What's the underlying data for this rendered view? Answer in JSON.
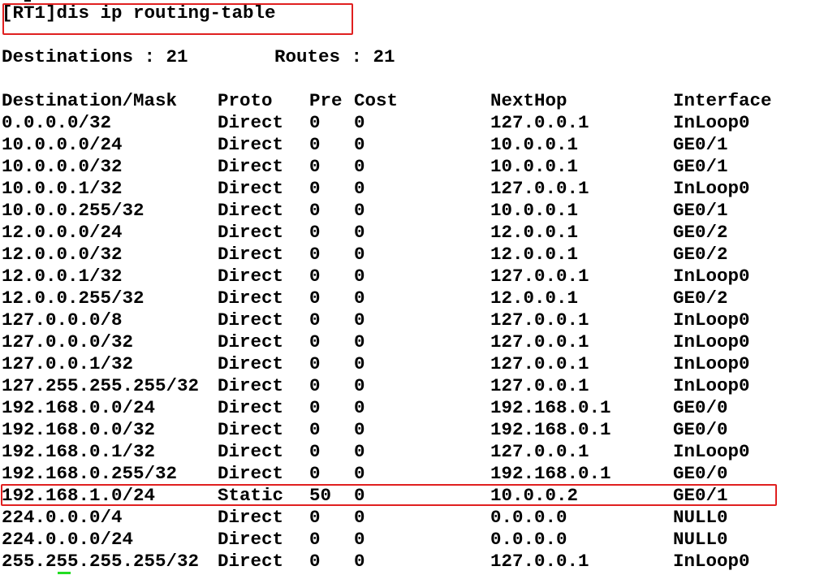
{
  "terminal": {
    "command_line": "[RT1]dis ip routing-table",
    "summary": {
      "destinations": "Destinations : 21",
      "routes": "Routes : 21"
    },
    "headers": {
      "destination_mask": "Destination/Mask",
      "proto": "Proto",
      "pre": "Pre",
      "cost": "Cost",
      "nexthop": "NextHop",
      "interface": "Interface"
    },
    "rows": [
      {
        "dest": "0.0.0.0/32",
        "proto": "Direct",
        "pre": "0",
        "cost": "0",
        "nexthop": "127.0.0.1",
        "iface": "InLoop0"
      },
      {
        "dest": "10.0.0.0/24",
        "proto": "Direct",
        "pre": "0",
        "cost": "0",
        "nexthop": "10.0.0.1",
        "iface": "GE0/1"
      },
      {
        "dest": "10.0.0.0/32",
        "proto": "Direct",
        "pre": "0",
        "cost": "0",
        "nexthop": "10.0.0.1",
        "iface": "GE0/1"
      },
      {
        "dest": "10.0.0.1/32",
        "proto": "Direct",
        "pre": "0",
        "cost": "0",
        "nexthop": "127.0.0.1",
        "iface": "InLoop0"
      },
      {
        "dest": "10.0.0.255/32",
        "proto": "Direct",
        "pre": "0",
        "cost": "0",
        "nexthop": "10.0.0.1",
        "iface": "GE0/1"
      },
      {
        "dest": "12.0.0.0/24",
        "proto": "Direct",
        "pre": "0",
        "cost": "0",
        "nexthop": "12.0.0.1",
        "iface": "GE0/2"
      },
      {
        "dest": "12.0.0.0/32",
        "proto": "Direct",
        "pre": "0",
        "cost": "0",
        "nexthop": "12.0.0.1",
        "iface": "GE0/2"
      },
      {
        "dest": "12.0.0.1/32",
        "proto": "Direct",
        "pre": "0",
        "cost": "0",
        "nexthop": "127.0.0.1",
        "iface": "InLoop0"
      },
      {
        "dest": "12.0.0.255/32",
        "proto": "Direct",
        "pre": "0",
        "cost": "0",
        "nexthop": "12.0.0.1",
        "iface": "GE0/2"
      },
      {
        "dest": "127.0.0.0/8",
        "proto": "Direct",
        "pre": "0",
        "cost": "0",
        "nexthop": "127.0.0.1",
        "iface": "InLoop0"
      },
      {
        "dest": "127.0.0.0/32",
        "proto": "Direct",
        "pre": "0",
        "cost": "0",
        "nexthop": "127.0.0.1",
        "iface": "InLoop0"
      },
      {
        "dest": "127.0.0.1/32",
        "proto": "Direct",
        "pre": "0",
        "cost": "0",
        "nexthop": "127.0.0.1",
        "iface": "InLoop0"
      },
      {
        "dest": "127.255.255.255/32",
        "proto": "Direct",
        "pre": "0",
        "cost": "0",
        "nexthop": "127.0.0.1",
        "iface": "InLoop0"
      },
      {
        "dest": "192.168.0.0/24",
        "proto": "Direct",
        "pre": "0",
        "cost": "0",
        "nexthop": "192.168.0.1",
        "iface": "GE0/0"
      },
      {
        "dest": "192.168.0.0/32",
        "proto": "Direct",
        "pre": "0",
        "cost": "0",
        "nexthop": "192.168.0.1",
        "iface": "GE0/0"
      },
      {
        "dest": "192.168.0.1/32",
        "proto": "Direct",
        "pre": "0",
        "cost": "0",
        "nexthop": "127.0.0.1",
        "iface": "InLoop0"
      },
      {
        "dest": "192.168.0.255/32",
        "proto": "Direct",
        "pre": "0",
        "cost": "0",
        "nexthop": "192.168.0.1",
        "iface": "GE0/0"
      },
      {
        "dest": "192.168.1.0/24",
        "proto": "Static",
        "pre": "50",
        "cost": "0",
        "nexthop": "10.0.0.2",
        "iface": "GE0/1"
      },
      {
        "dest": "224.0.0.0/4",
        "proto": "Direct",
        "pre": "0",
        "cost": "0",
        "nexthop": "0.0.0.0",
        "iface": "NULL0"
      },
      {
        "dest": "224.0.0.0/24",
        "proto": "Direct",
        "pre": "0",
        "cost": "0",
        "nexthop": "0.0.0.0",
        "iface": "NULL0"
      },
      {
        "dest": "255.255.255.255/32",
        "proto": "Direct",
        "pre": "0",
        "cost": "0",
        "nexthop": "127.0.0.1",
        "iface": "InLoop0"
      }
    ]
  },
  "colors": {
    "highlight_border": "#e02020",
    "cursor": "#22dd22",
    "text": "#000000",
    "background": "#ffffff"
  }
}
